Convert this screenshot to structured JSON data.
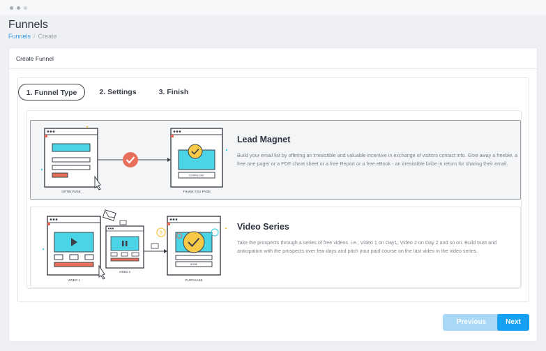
{
  "page": {
    "title": "Funnels"
  },
  "breadcrumb": {
    "root": "Funnels",
    "separator": "/",
    "current": "Create"
  },
  "card": {
    "title": "Create Funnel"
  },
  "steps": [
    {
      "label": "1. Funnel Type",
      "active": true
    },
    {
      "label": "2. Settings",
      "active": false
    },
    {
      "label": "3. Finish",
      "active": false
    }
  ],
  "options": [
    {
      "title": "Lead Magnet",
      "description": "Build your email list by offering an irresistible and valuable incentive in exchange of visitors contact info. Give away a freebie, a free one pager or a PDF cheat sheet or a free Report or a free eBook - an irresistible bribe in return for sharing their email.",
      "selected": true,
      "illustration": {
        "page_left": "OPTIN PAGE",
        "page_right": "THANK YOU PAGE",
        "button": "DOWNLOAD"
      }
    },
    {
      "title": "Video Series",
      "description": "Take the prospects through a series of free videos. i.e., Video 1 on Day1, Video 2 on Day 2 and so on. Build trust and anticipation with the prospects over few days and pitch your paid course on the last video in the video series.",
      "selected": false,
      "illustration": {
        "page_one": "VIDEO 1",
        "page_two": "VIDEO 2",
        "page_three": "PURCHASE",
        "button": "DONE"
      }
    }
  ],
  "buttons": {
    "previous": "Previous",
    "next": "Next"
  },
  "colors": {
    "accent": "#16a0f4",
    "accent_disabled": "#a9d8f7",
    "illus_cyan": "#4ad4e6",
    "illus_salmon": "#e8705a",
    "illus_yellow": "#f7c948"
  }
}
